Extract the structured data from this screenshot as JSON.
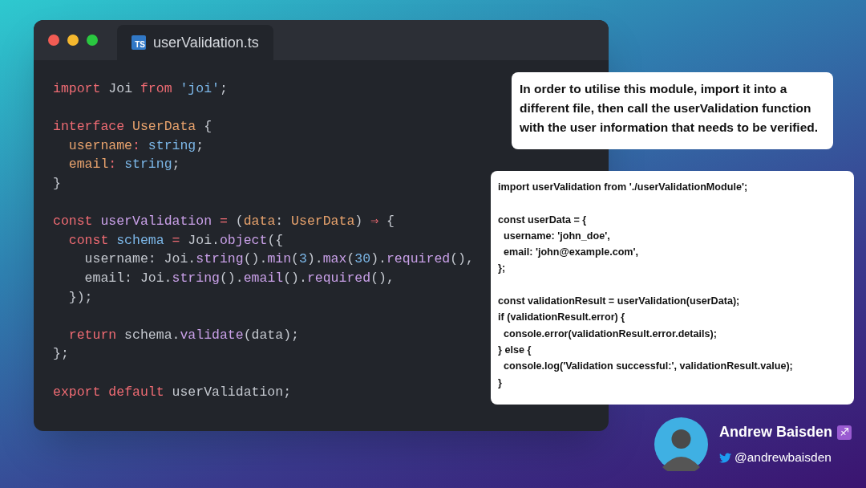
{
  "editor": {
    "tab": {
      "icon_text": "TS",
      "label": "userValidation.ts"
    },
    "blocks": [
      [
        [
          {
            "text": "import",
            "kind": "keyword"
          },
          {
            "text": " Joi ",
            "kind": "plain"
          },
          {
            "text": "from",
            "kind": "keyword"
          },
          {
            "text": " 'joi'",
            "kind": "string"
          },
          {
            "text": ";",
            "kind": "plain"
          }
        ]
      ],
      [
        [
          {
            "text": "interface",
            "kind": "keyword"
          },
          {
            "text": " UserData",
            "kind": "type"
          },
          {
            "text": " {",
            "kind": "plain"
          }
        ],
        [
          {
            "text": "  username",
            "kind": "type"
          },
          {
            "text": ": ",
            "kind": "keyword"
          },
          {
            "text": "string",
            "kind": "string"
          },
          {
            "text": ";",
            "kind": "plain"
          }
        ],
        [
          {
            "text": "  email",
            "kind": "type"
          },
          {
            "text": ": ",
            "kind": "keyword"
          },
          {
            "text": "string",
            "kind": "string"
          },
          {
            "text": ";",
            "kind": "plain"
          }
        ],
        [
          {
            "text": "}",
            "kind": "plain"
          }
        ]
      ],
      [
        [
          {
            "text": "const",
            "kind": "keyword"
          },
          {
            "text": " userValidation",
            "kind": "function"
          },
          {
            "text": " = ",
            "kind": "keyword"
          },
          {
            "text": "(",
            "kind": "plain"
          },
          {
            "text": "data",
            "kind": "type"
          },
          {
            "text": ": ",
            "kind": "plain"
          },
          {
            "text": "UserData",
            "kind": "type"
          },
          {
            "text": ") ",
            "kind": "plain"
          },
          {
            "text": "⇒",
            "kind": "keyword"
          },
          {
            "text": " {",
            "kind": "plain"
          }
        ],
        [
          {
            "text": "  const",
            "kind": "keyword"
          },
          {
            "text": " schema",
            "kind": "string"
          },
          {
            "text": " = ",
            "kind": "keyword"
          },
          {
            "text": "Joi.",
            "kind": "plain"
          },
          {
            "text": "object",
            "kind": "function"
          },
          {
            "text": "({",
            "kind": "plain"
          }
        ],
        [
          {
            "text": "    username: Joi.",
            "kind": "plain"
          },
          {
            "text": "string",
            "kind": "function"
          },
          {
            "text": "().",
            "kind": "plain"
          },
          {
            "text": "min",
            "kind": "function"
          },
          {
            "text": "(",
            "kind": "plain"
          },
          {
            "text": "3",
            "kind": "string"
          },
          {
            "text": ").",
            "kind": "plain"
          },
          {
            "text": "max",
            "kind": "function"
          },
          {
            "text": "(",
            "kind": "plain"
          },
          {
            "text": "30",
            "kind": "string"
          },
          {
            "text": ").",
            "kind": "plain"
          },
          {
            "text": "required",
            "kind": "function"
          },
          {
            "text": "(),",
            "kind": "plain"
          }
        ],
        [
          {
            "text": "    email: Joi.",
            "kind": "plain"
          },
          {
            "text": "string",
            "kind": "function"
          },
          {
            "text": "().",
            "kind": "plain"
          },
          {
            "text": "email",
            "kind": "function"
          },
          {
            "text": "().",
            "kind": "plain"
          },
          {
            "text": "required",
            "kind": "function"
          },
          {
            "text": "(),",
            "kind": "plain"
          }
        ],
        [
          {
            "text": "  });",
            "kind": "plain"
          }
        ]
      ],
      [
        [
          {
            "text": "  return",
            "kind": "keyword"
          },
          {
            "text": " schema.",
            "kind": "plain"
          },
          {
            "text": "validate",
            "kind": "function"
          },
          {
            "text": "(data);",
            "kind": "plain"
          }
        ],
        [
          {
            "text": "};",
            "kind": "plain"
          }
        ]
      ],
      [
        [
          {
            "text": "export",
            "kind": "keyword"
          },
          {
            "text": " default",
            "kind": "keyword"
          },
          {
            "text": " userValidation;",
            "kind": "plain"
          }
        ]
      ]
    ]
  },
  "note": "In order to utilise this module, import it into a different file, then call the userValidation function with the user information that needs to be verified.",
  "usage_code": [
    [
      "import userValidation from './userValidationModule';"
    ],
    [
      "const userData = {",
      "  username: 'john_doe',",
      "  email: 'john@example.com',",
      "};"
    ],
    [
      "const validationResult = userValidation(userData);",
      "if (validationResult.error) {",
      "  console.error(validationResult.error.details);",
      "} else {",
      "  console.log('Validation successful:', validationResult.value);",
      "}"
    ]
  ],
  "author": {
    "name": "Andrew Baisden",
    "badge": "♐",
    "handle": "@andrewbaisden"
  }
}
